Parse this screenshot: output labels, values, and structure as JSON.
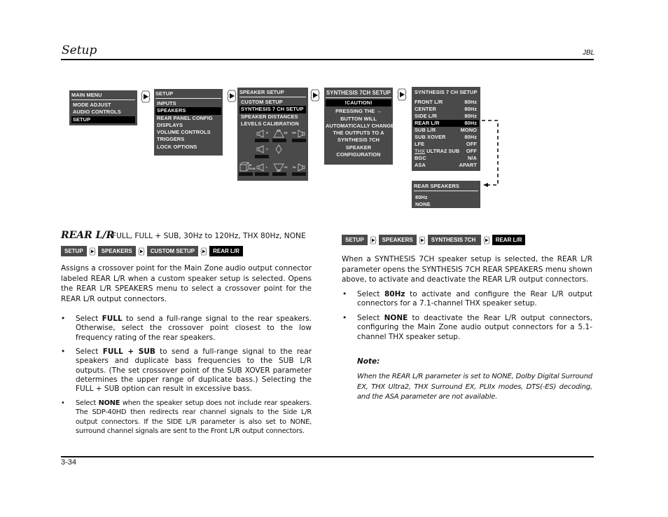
{
  "header": {
    "title": "Setup",
    "brand": "JBL"
  },
  "footer": {
    "page_number": "3-34"
  },
  "diagram": {
    "main_menu": {
      "title": "MAIN MENU",
      "items": [
        "MODE ADJUST",
        "AUDIO CONTROLS",
        "SETUP"
      ],
      "selected": "SETUP"
    },
    "setup_menu": {
      "title": "SETUP",
      "items": [
        "INPUTS",
        "SPEAKERS",
        "REAR PANEL CONFIG",
        "DISPLAYS",
        "VOLUME CONTROLS",
        "TRIGGERS",
        "LOCK OPTIONS"
      ],
      "selected": "SPEAKERS"
    },
    "speaker_setup_menu": {
      "title": "SPEAKER SETUP",
      "items": [
        "CUSTOM SETUP",
        "SYNTHESIS 7 CH SETUP",
        "SPEAKER DISTANCES",
        "LEVELS CALIBRATION"
      ],
      "selected": "SYNTHESIS 7 CH SETUP",
      "speaker_labels": {
        "front_right": "R",
        "side_right": "SR",
        "rear_right": "RR",
        "center": "C",
        "sub": "M SUB",
        "front_left": "L",
        "side_left": "SL",
        "rear_left": "RL"
      }
    },
    "synthesis_caution": {
      "title": "SYNTHESIS 7CH SETUP",
      "caution": "!CAUTION!",
      "lines": [
        "PRESSING THE →",
        "BUTTON WILL",
        "AUTOMATICALLY CHANGE",
        "THE OUTPUTS TO A",
        "SYNTHESIS 7CH",
        "SPEAKER",
        "CONFIGURATION"
      ]
    },
    "synthesis_setup": {
      "title": "SYNTHESIS 7 CH SETUP",
      "rows": [
        {
          "label": "FRONT L/R",
          "value": "80Hz"
        },
        {
          "label": "CENTER",
          "value": "80Hz"
        },
        {
          "label": "SIDE L/R",
          "value": "80Hz"
        },
        {
          "label": "REAR L/R",
          "value": "80Hz"
        },
        {
          "label": "SUB L/R",
          "value": "MONO"
        },
        {
          "label": "SUB XOVER",
          "value": "80Hz"
        },
        {
          "label": "LFE",
          "value": "OFF"
        },
        {
          "label": "THX ULTRA2 SUB",
          "value": "OFF"
        },
        {
          "label": "BGC",
          "value": "N/A"
        },
        {
          "label": "ASA",
          "value": "APART"
        }
      ],
      "selected": "REAR L/R",
      "thx_logo": "THX",
      "ultra2_label": "ULTRA2 SUB"
    },
    "rear_speakers": {
      "title": "REAR SPEAKERS",
      "items": [
        "80Hz",
        "NONE"
      ]
    }
  },
  "left": {
    "title": "REAR L/R",
    "options": "FULL, FULL + SUB, 30Hz to 120Hz, THX 80Hz, NONE",
    "breadcrumb": [
      "SETUP",
      "SPEAKERS",
      "CUSTOM SETUP",
      "REAR L/R"
    ],
    "intro": "Assigns a crossover point for the Main Zone audio output connector labeled REAR L/R when a custom speaker setup is selected. Opens the REAR L/R SPEAKERS menu to select a crossover point for the REAR L/R output connectors.",
    "bullets": [
      {
        "pre": "Select ",
        "bold": "FULL",
        "post": " to send a full-range signal to the rear speakers. Otherwise, select the crossover point closest to the low frequency rating of the rear speakers."
      },
      {
        "pre": "Select ",
        "bold": "FULL + SUB",
        "post": " to send a full-range signal to the rear speakers and duplicate bass frequencies to the SUB L/R outputs. (The set crossover point of the SUB XOVER parameter determines the upper range of duplicate bass.) Selecting the FULL + SUB option can result in excessive bass."
      },
      {
        "pre": "Select ",
        "bold": "NONE",
        "post": " when the speaker setup does not include rear speakers. The SDP-40HD then redirects rear channel signals to the Side L/R output connectors. If the SIDE L/R parameter is also set to NONE, surround channel signals are sent to the Front L/R output connectors."
      }
    ]
  },
  "right": {
    "breadcrumb": [
      "SETUP",
      "SPEAKERS",
      "SYNTHESIS 7CH",
      "REAR L/R"
    ],
    "intro": "When a SYNTHESIS 7CH speaker setup is selected, the REAR L/R parameter opens the SYNTHESIS 7CH REAR SPEAKERS menu shown above, to activate and deactivate the REAR L/R output connectors.",
    "bullets": [
      {
        "pre": "Select ",
        "bold": "80Hz",
        "post": " to activate and configure the Rear L/R output connectors for a 7.1-channel THX speaker setup."
      },
      {
        "pre": "Select ",
        "bold": "NONE",
        "post": " to deactivate the Rear L/R output connectors, configuring the Main Zone audio output connectors for a 5.1-channel THX speaker setup."
      }
    ],
    "note_title": "Note:",
    "note_body": "When the REAR L/R parameter is set to NONE, Dolby Digital Surround EX, THX Ultra2, THX Surround EX, PLIIx modes, DTS(-ES) decoding, and the ASA parameter are not available."
  },
  "bullet_char": "•",
  "colors": {
    "osd_bg": "#4a4a4a",
    "osd_selected": "#000000",
    "text": "#111111"
  }
}
